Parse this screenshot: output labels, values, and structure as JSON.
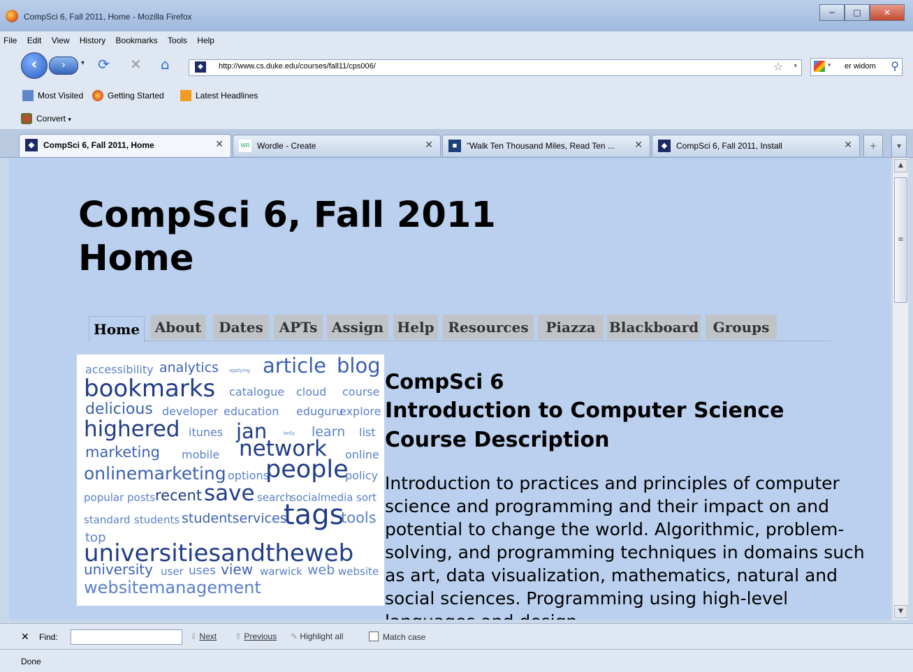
{
  "window": {
    "title": "CompSci 6, Fall 2011, Home - Mozilla Firefox"
  },
  "menu": [
    "File",
    "Edit",
    "View",
    "History",
    "Bookmarks",
    "Tools",
    "Help"
  ],
  "navbar": {
    "url": "http://www.cs.duke.edu/courses/fall11/cps006/",
    "search_query": "er widom"
  },
  "bookmarks": [
    "Most Visited",
    "Getting Started",
    "Latest Headlines"
  ],
  "convert_label": "Convert",
  "tabs": [
    {
      "label": "CompSci 6, Fall 2011, Home",
      "active": true
    },
    {
      "label": "Wordle - Create",
      "active": false
    },
    {
      "label": "\"Walk Ten Thousand Miles, Read Ten ...",
      "active": false
    },
    {
      "label": "CompSci 6, Fall 2011, Install",
      "active": false
    }
  ],
  "page": {
    "title_line1": "CompSci 6, Fall 2011",
    "title_line2": "Home",
    "nav": [
      "Home",
      "About",
      "Dates",
      "APTs",
      "Assign",
      "Help",
      "Resources",
      "Piazza",
      "Blackboard",
      "Groups"
    ],
    "active_nav": "Home",
    "heading_line1": "CompSci 6",
    "heading_line2": "Introduction to Computer Science",
    "heading_line3": "Course Description",
    "description": "Introduction to practices and principles of computer science and programming and their impact on and potential to change the world. Algorithmic, problem-solving, and programming techniques in domains such as art, data visualization, mathematics, natural and social sciences. Programming using high-level languages and design",
    "wordle_words": [
      "accessibility",
      "analytics",
      "applying",
      "article",
      "blog",
      "bookmarks",
      "catalogue",
      "cloud",
      "course",
      "delicious",
      "developer",
      "education",
      "eduguru",
      "explore",
      "highered",
      "itunes",
      "jan",
      "kelly",
      "learn",
      "list",
      "marketing",
      "mobile",
      "network",
      "online",
      "onlinemarketing",
      "options",
      "people",
      "policy",
      "popular posts",
      "recent",
      "save",
      "search",
      "socialmedia",
      "sort",
      "standard",
      "students",
      "studentservices",
      "tags",
      "tools",
      "top",
      "universitiesandtheweb",
      "university",
      "user",
      "uses",
      "view",
      "warwick",
      "web",
      "website",
      "websitemanagement"
    ]
  },
  "findbar": {
    "label": "Find:",
    "value": "",
    "next": "Next",
    "previous": "Previous",
    "highlight": "Highlight all",
    "match_case": "Match case"
  },
  "status": "Done"
}
